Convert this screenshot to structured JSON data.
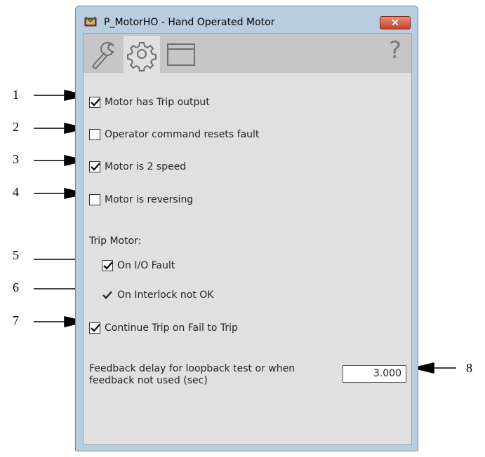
{
  "window": {
    "title": "P_MotorHO - Hand Operated Motor",
    "close_label": "✕"
  },
  "tabs": [
    {
      "name": "wrench",
      "icon": "wrench-icon"
    },
    {
      "name": "settings",
      "icon": "gear-icon",
      "active": true
    },
    {
      "name": "window",
      "icon": "window-icon"
    }
  ],
  "help_label": "?",
  "options": [
    {
      "label": "Motor has Trip output",
      "checked": true
    },
    {
      "label": "Operator command resets fault",
      "checked": false
    },
    {
      "label": "Motor is 2 speed",
      "checked": true
    },
    {
      "label": "Motor is reversing",
      "checked": false
    }
  ],
  "trip_motor": {
    "heading": "Trip Motor:",
    "on_io_fault": {
      "label": "On I/O Fault",
      "checked": true
    },
    "on_interlock": {
      "label": "On Interlock not OK",
      "checked": true
    }
  },
  "continue_trip": {
    "label": "Continue Trip on Fail to Trip",
    "checked": true
  },
  "feedback": {
    "label_line1": "Feedback delay for loopback test or when",
    "label_line2": "feedback not used (sec)",
    "value": "3.000"
  },
  "callouts": [
    "1",
    "2",
    "3",
    "4",
    "5",
    "6",
    "7",
    "8"
  ]
}
